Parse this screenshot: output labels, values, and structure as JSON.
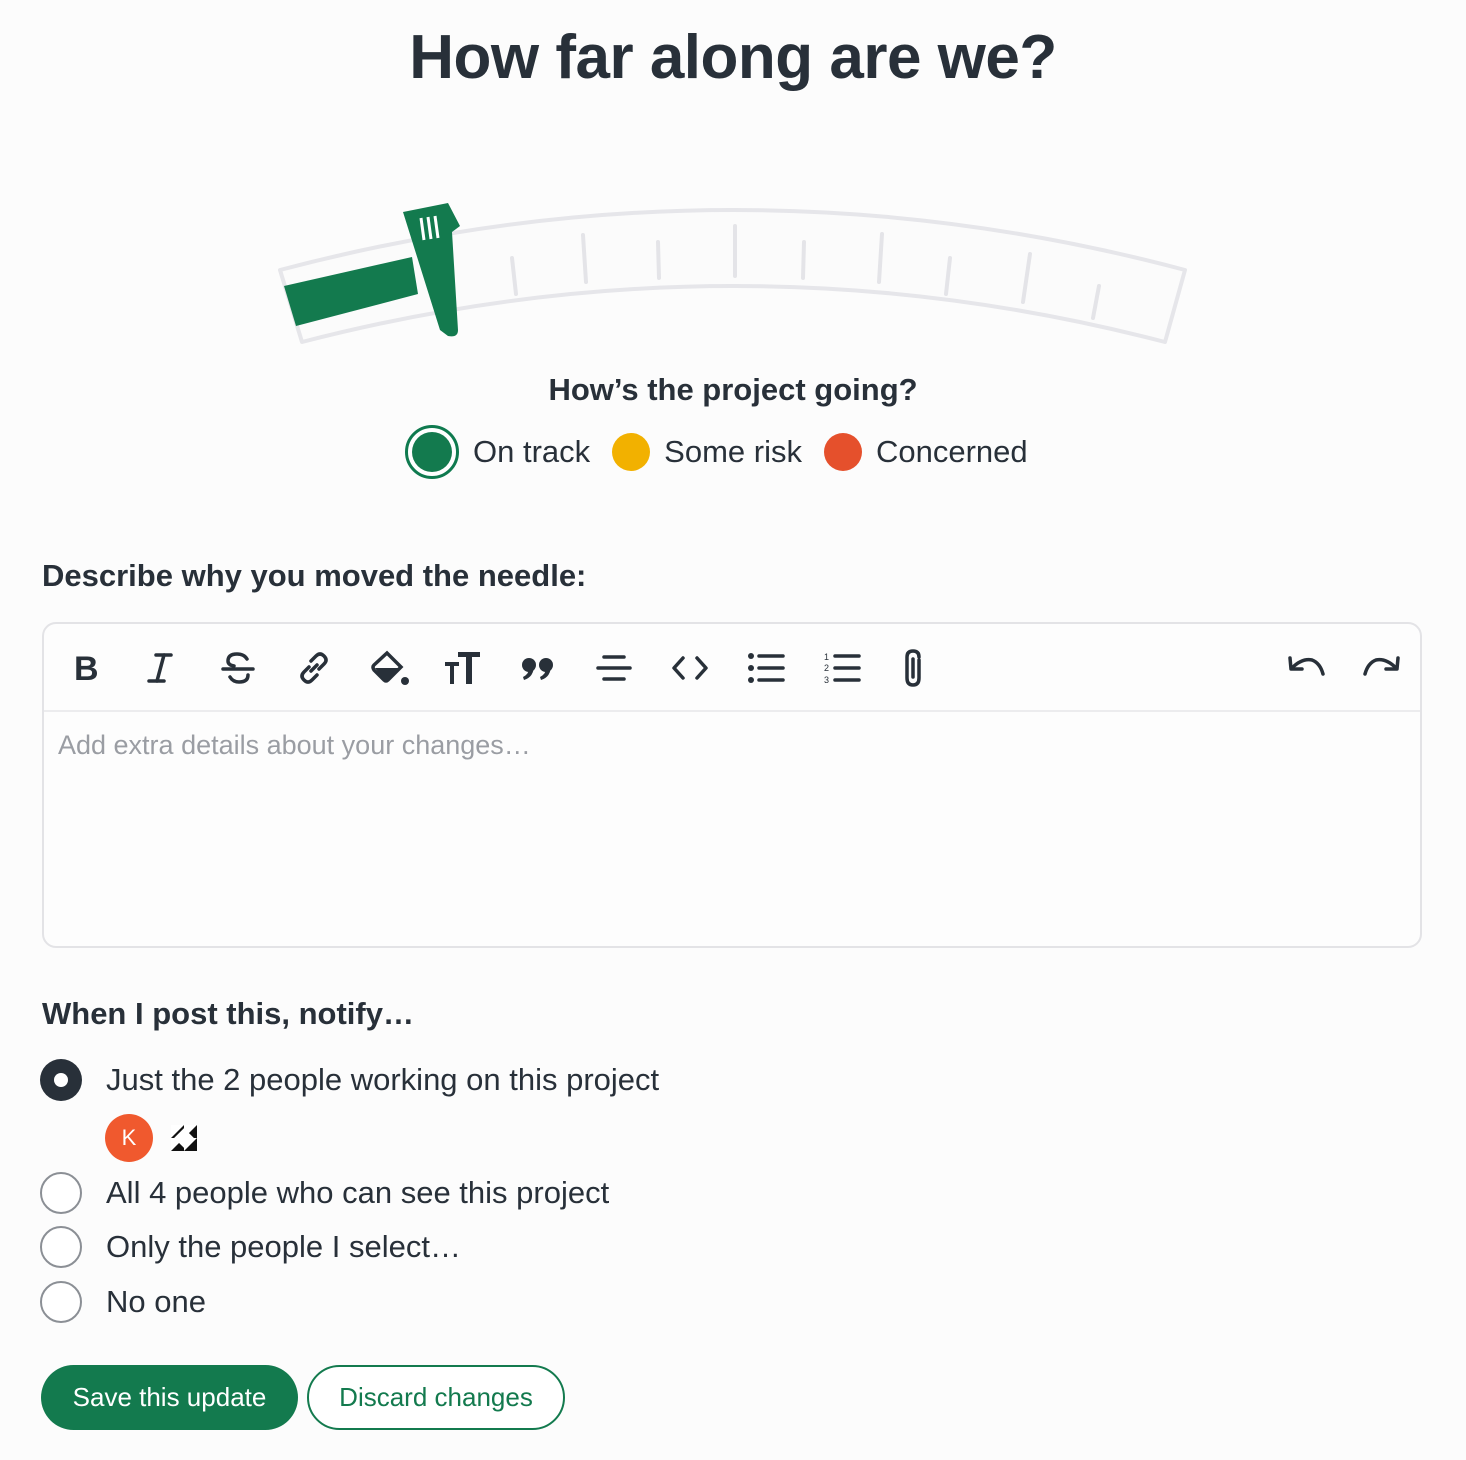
{
  "heading": "How far along are we?",
  "progress": {
    "percent": 15
  },
  "status": {
    "question": "How’s the project going?",
    "options": [
      {
        "label": "On track",
        "color": "#137a4e",
        "selected": true
      },
      {
        "label": "Some risk",
        "color": "#f2b100",
        "selected": false
      },
      {
        "label": "Concerned",
        "color": "#e5502c",
        "selected": false
      }
    ]
  },
  "description": {
    "label": "Describe why you moved the needle:",
    "placeholder": "Add extra details about your changes…",
    "toolbar": [
      "bold-icon",
      "italic-icon",
      "strikethrough-icon",
      "link-icon",
      "highlight-icon",
      "text-size-icon",
      "quote-icon",
      "align-center-icon",
      "code-icon",
      "bullet-list-icon",
      "numbered-list-icon",
      "attachment-icon",
      "undo-icon",
      "redo-icon"
    ]
  },
  "notify": {
    "label": "When I post this, notify…",
    "options": [
      {
        "label": "Just the 2 people working on this project",
        "checked": true
      },
      {
        "label": "All 4 people who can see this project",
        "checked": false
      },
      {
        "label": "Only the people I select…",
        "checked": false
      },
      {
        "label": "No one",
        "checked": false
      }
    ],
    "avatar_initial": "K"
  },
  "actions": {
    "save_label": "Save this update",
    "discard_label": "Discard changes"
  }
}
